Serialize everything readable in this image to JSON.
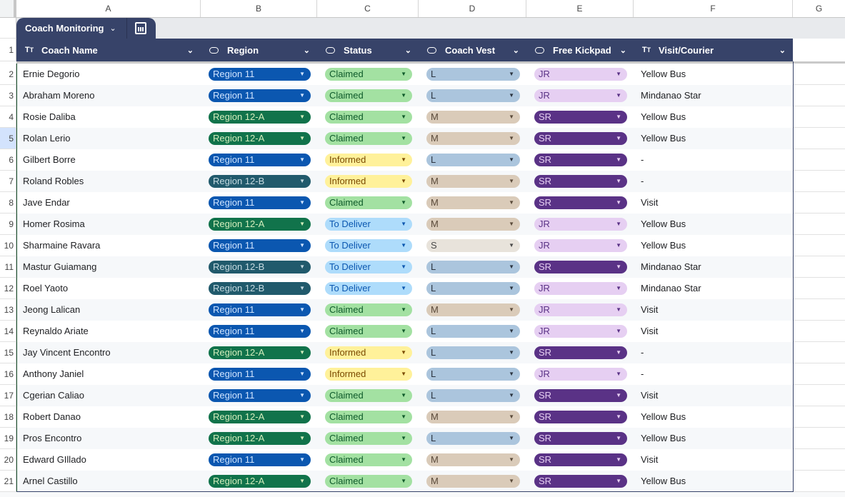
{
  "columns": [
    "A",
    "B",
    "C",
    "D",
    "E",
    "F",
    "G"
  ],
  "table": {
    "name": "Coach Monitoring",
    "headers": [
      {
        "label": "Coach Name",
        "type_icon": "text-type-icon"
      },
      {
        "label": "Region",
        "type_icon": "dropdown-chip-icon"
      },
      {
        "label": "Status",
        "type_icon": "dropdown-chip-icon"
      },
      {
        "label": "Coach Vest",
        "type_icon": "dropdown-chip-icon"
      },
      {
        "label": "Free Kickpad",
        "type_icon": "dropdown-chip-icon"
      },
      {
        "label": "Visit/Courier",
        "type_icon": "text-type-icon"
      }
    ]
  },
  "colors": {
    "Region 11": [
      "#0b57b0",
      "#d0e4ff"
    ],
    "Region 12-A": [
      "#11734b",
      "#d4edbc"
    ],
    "Region 12-B": [
      "#215a6c",
      "#c6dbe1"
    ],
    "Claimed": [
      "#a3e1a2",
      "#0e5a2a"
    ],
    "Informed": [
      "#fff19a",
      "#7a4a00"
    ],
    "To Deliver": [
      "#aedcfb",
      "#0b57b0"
    ],
    "L": [
      "#abc5dd",
      "#2b3440"
    ],
    "M": [
      "#dacbb9",
      "#5a4a3a"
    ],
    "S": [
      "#e8e3db",
      "#4a4a4a"
    ],
    "JR": [
      "#e6cff2",
      "#5a3286"
    ],
    "SR": [
      "#5a3286",
      "#e6cff2"
    ]
  },
  "rows": [
    {
      "n": "2",
      "name": "Ernie Degorio",
      "region": "Region 11",
      "status": "Claimed",
      "vest": "L",
      "kickpad": "JR",
      "visit": "Yellow Bus"
    },
    {
      "n": "3",
      "name": "Abraham Moreno",
      "region": "Region 11",
      "status": "Claimed",
      "vest": "L",
      "kickpad": "JR",
      "visit": "Mindanao Star"
    },
    {
      "n": "4",
      "name": "Rosie Daliba",
      "region": "Region 12-A",
      "status": "Claimed",
      "vest": "M",
      "kickpad": "SR",
      "visit": "Yellow Bus"
    },
    {
      "n": "5",
      "name": "Rolan Lerio",
      "region": "Region 12-A",
      "status": "Claimed",
      "vest": "M",
      "kickpad": "SR",
      "visit": "Yellow Bus"
    },
    {
      "n": "6",
      "name": "Gilbert Borre",
      "region": "Region 11",
      "status": "Informed",
      "vest": "L",
      "kickpad": "SR",
      "visit": "-"
    },
    {
      "n": "7",
      "name": "Roland Robles",
      "region": "Region 12-B",
      "status": "Informed",
      "vest": "M",
      "kickpad": "SR",
      "visit": "-"
    },
    {
      "n": "8",
      "name": "Jave Endar",
      "region": "Region 11",
      "status": "Claimed",
      "vest": "M",
      "kickpad": "SR",
      "visit": "Visit"
    },
    {
      "n": "9",
      "name": "Homer Rosima",
      "region": "Region 12-A",
      "status": "To Deliver",
      "vest": "M",
      "kickpad": "JR",
      "visit": "Yellow Bus"
    },
    {
      "n": "10",
      "name": "Sharmaine Ravara",
      "region": "Region 11",
      "status": "To Deliver",
      "vest": "S",
      "kickpad": "JR",
      "visit": "Yellow Bus"
    },
    {
      "n": "11",
      "name": "Mastur Guiamang",
      "region": "Region 12-B",
      "status": "To Deliver",
      "vest": "L",
      "kickpad": "SR",
      "visit": "Mindanao Star"
    },
    {
      "n": "12",
      "name": "Roel Yaoto",
      "region": "Region 12-B",
      "status": "To Deliver",
      "vest": "L",
      "kickpad": "JR",
      "visit": "Mindanao Star"
    },
    {
      "n": "13",
      "name": "Jeong Lalican",
      "region": "Region 11",
      "status": "Claimed",
      "vest": "M",
      "kickpad": "JR",
      "visit": "Visit"
    },
    {
      "n": "14",
      "name": "Reynaldo Ariate",
      "region": "Region 11",
      "status": "Claimed",
      "vest": "L",
      "kickpad": "JR",
      "visit": "Visit"
    },
    {
      "n": "15",
      "name": "Jay Vincent Encontro",
      "region": "Region 12-A",
      "status": "Informed",
      "vest": "L",
      "kickpad": "SR",
      "visit": "-"
    },
    {
      "n": "16",
      "name": "Anthony Janiel",
      "region": "Region 11",
      "status": "Informed",
      "vest": "L",
      "kickpad": "JR",
      "visit": "-"
    },
    {
      "n": "17",
      "name": "Cgerian Caliao",
      "region": "Region 11",
      "status": "Claimed",
      "vest": "L",
      "kickpad": "SR",
      "visit": "Visit"
    },
    {
      "n": "18",
      "name": "Robert Danao",
      "region": "Region 12-A",
      "status": "Claimed",
      "vest": "M",
      "kickpad": "SR",
      "visit": "Yellow Bus"
    },
    {
      "n": "19",
      "name": "Pros Encontro",
      "region": "Region 12-A",
      "status": "Claimed",
      "vest": "L",
      "kickpad": "SR",
      "visit": "Yellow Bus"
    },
    {
      "n": "20",
      "name": "Edward GIllado",
      "region": "Region 11",
      "status": "Claimed",
      "vest": "M",
      "kickpad": "SR",
      "visit": "Visit"
    },
    {
      "n": "21",
      "name": "Arnel Castillo",
      "region": "Region 12-A",
      "status": "Claimed",
      "vest": "M",
      "kickpad": "SR",
      "visit": "Yellow Bus"
    }
  ],
  "header_row_number": "1",
  "selected_row": "5"
}
